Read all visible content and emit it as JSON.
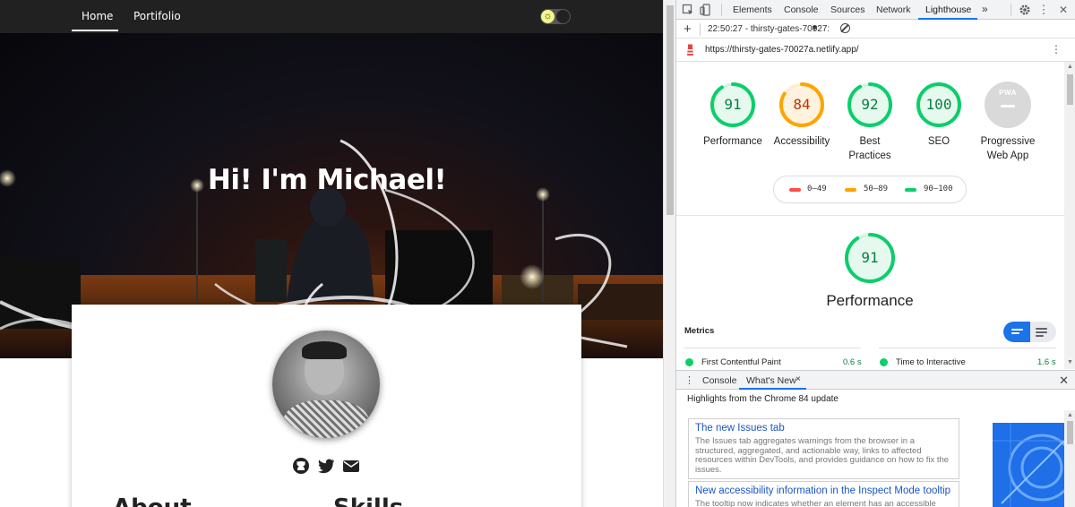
{
  "site": {
    "nav": {
      "home": "Home",
      "portfolio": "Portifolio"
    },
    "hero_title": "Hi! I'm Michael!",
    "sections": {
      "about": "About",
      "skills": "Skills"
    },
    "socials": [
      "github-icon",
      "twitter-icon",
      "envelope-icon"
    ]
  },
  "devtools": {
    "tabs": [
      "Elements",
      "Console",
      "Sources",
      "Network",
      "Lighthouse"
    ],
    "active_tab": "Lighthouse",
    "more_tabs": "»",
    "report_time": "22:50:27 - thirsty-gates-70027:",
    "url": "https://thirsty-gates-70027a.netlify.app/",
    "gauges": [
      {
        "score": "91",
        "label1": "Performance",
        "label2": "",
        "color": "#0cce6b"
      },
      {
        "score": "84",
        "label1": "Accessibility",
        "label2": "",
        "color": "#ffa400"
      },
      {
        "score": "92",
        "label1": "Best",
        "label2": "Practices",
        "color": "#0cce6b"
      },
      {
        "score": "100",
        "label1": "SEO",
        "label2": "",
        "color": "#0cce6b"
      },
      {
        "score": "PWA",
        "label1": "Progressive",
        "label2": "Web App",
        "color": "#9e9e9e"
      }
    ],
    "legend": [
      {
        "range": "0–49",
        "color": "#ff4e42"
      },
      {
        "range": "50–89",
        "color": "#ffa400"
      },
      {
        "range": "90–100",
        "color": "#0cce6b"
      }
    ],
    "category": {
      "score": "91",
      "title": "Performance"
    },
    "metrics_heading": "Metrics",
    "metrics": [
      {
        "name": "First Contentful Paint",
        "value": "0.6 s"
      },
      {
        "name": "Time to Interactive",
        "value": "1.6 s"
      }
    ],
    "drawer": {
      "tabs": [
        "Console",
        "What's New"
      ],
      "close_tab": "×",
      "highlights": "Highlights from the Chrome 84 update",
      "cards": [
        {
          "title": "The new Issues tab",
          "desc": "The Issues tab aggregates warnings from the browser in a structured, aggregated, and actionable way, links to affected resources within DevTools, and provides guidance on how to fix the issues."
        },
        {
          "title": "New accessibility information in the Inspect Mode tooltip",
          "desc": "The tooltip now indicates whether an element has an accessible"
        }
      ]
    }
  }
}
